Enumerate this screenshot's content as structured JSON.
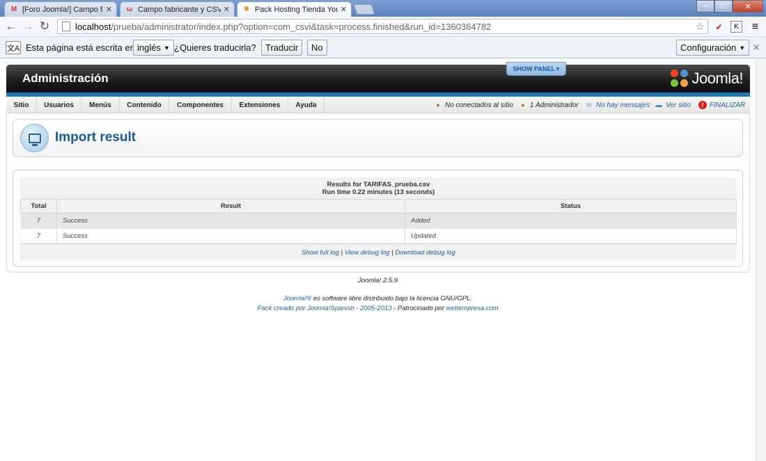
{
  "browser": {
    "tabs": [
      {
        "title": "[Foro Joomla!] Campo fab",
        "close": "✕",
        "favicon": "M"
      },
      {
        "title": "Campo fabricante y CSVI",
        "close": "✕",
        "favicon": "ω"
      },
      {
        "title": "Pack Hosting Tienda Your",
        "close": "✕",
        "favicon": "✱"
      }
    ],
    "window_buttons": {
      "minimize": "–",
      "maximize": "□",
      "close": "✕"
    },
    "nav": {
      "back": "←",
      "forward": "→",
      "reload": "↻"
    },
    "url_host": "localhost",
    "url_path": "/prueba/administrator/index.php?option=com_csvi&task=process.finished&run_id=1360364782",
    "star": "☆",
    "ext_icons": [
      "✔",
      "K",
      "≡"
    ],
    "translate_bar": {
      "icon": "文A",
      "text_before": "Esta página está escrita en",
      "language": "inglés",
      "question": "¿Quieres traducirla?",
      "translate_btn": "Traducir",
      "no_btn": "No",
      "options_btn": "Configuración",
      "close": "✕"
    }
  },
  "joomla": {
    "admin_title": "Administración",
    "show_panel": "SHOW PANEL",
    "logo_text": "Joomla!",
    "menu": [
      "Sitio",
      "Usuarios",
      "Menús",
      "Contenido",
      "Componentes",
      "Extensiones",
      "Ayuda"
    ],
    "status": [
      {
        "icon": "user-icon",
        "text": "No conectados al sitio"
      },
      {
        "icon": "admin-icon",
        "text": "1 Administrador"
      },
      {
        "icon": "mail-icon",
        "text": "No hay mensajes"
      },
      {
        "icon": "monitor-icon",
        "text": "Ver sitio"
      },
      {
        "icon": "logout-icon",
        "text": "FINALIZAR"
      }
    ],
    "page_title": "Import result",
    "results_for": "Results for TARIFAS_prueba.csv",
    "run_time": "Run time 0.22 minutes (13 seconds)",
    "table": {
      "headers": [
        "Total",
        "Result",
        "Status"
      ],
      "rows": [
        {
          "total": "7",
          "result": "Success",
          "status": "Added"
        },
        {
          "total": "7",
          "result": "Success",
          "status": "Updated"
        }
      ]
    },
    "log_links": [
      "Show full log",
      "View debug log",
      "Download debug log"
    ],
    "log_separator": "|",
    "footer": {
      "version": "Joomla! 2.5.9",
      "license_link": "Joomla!®",
      "license_text": " es software libre distribuido bajo la licencia GNU/GPL.",
      "pack_link": "Pack creado por Joomla!Spanish - 2005-2013",
      "sponsor_text": " - Patrocinado por ",
      "sponsor_link": "webempresa.com"
    }
  },
  "colors": {
    "accent_blue": "#1b77b5",
    "title_blue": "#1b5b91",
    "link_blue": "#1f5f9a",
    "header_dark": "#1c1c1c"
  }
}
